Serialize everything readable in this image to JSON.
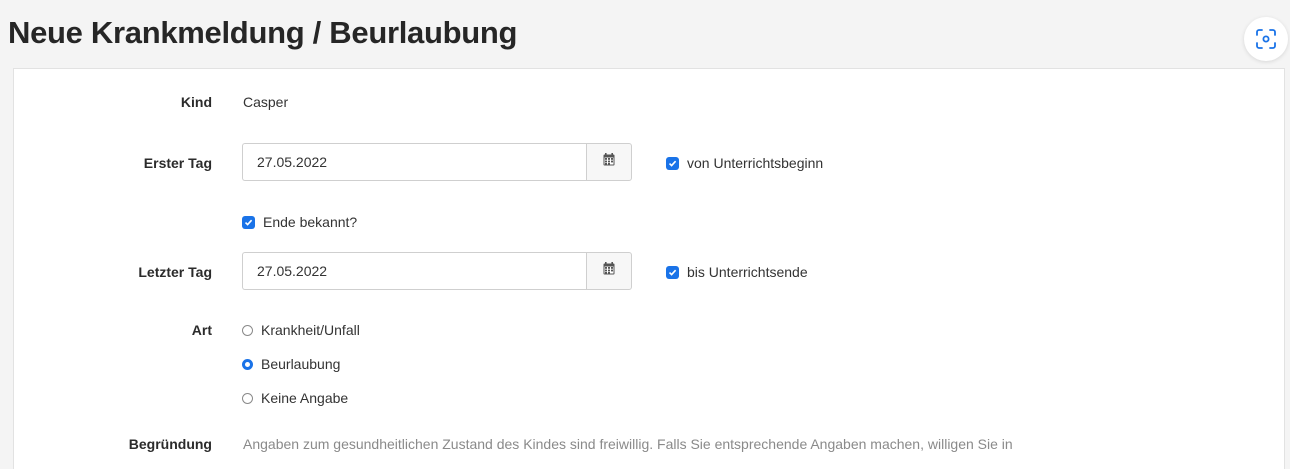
{
  "header": {
    "title": "Neue Krankmeldung / Beurlaubung",
    "screenshot_icon": "screenshot-capture-icon"
  },
  "form": {
    "kind": {
      "label": "Kind",
      "value": "Casper"
    },
    "erster_tag": {
      "label": "Erster Tag",
      "value": "27.05.2022",
      "calendar_icon": "calendar-icon",
      "option_label": "von Unterrichtsbeginn",
      "option_checked": true
    },
    "ende_bekannt": {
      "label": "Ende bekannt?",
      "checked": true
    },
    "letzter_tag": {
      "label": "Letzter Tag",
      "value": "27.05.2022",
      "calendar_icon": "calendar-icon",
      "option_label": "bis Unterrichtsende",
      "option_checked": true
    },
    "art": {
      "label": "Art",
      "options": [
        {
          "label": "Krankheit/Unfall",
          "selected": false
        },
        {
          "label": "Beurlaubung",
          "selected": true
        },
        {
          "label": "Keine Angabe",
          "selected": false
        }
      ]
    },
    "begruendung": {
      "label": "Begründung",
      "hint": "Angaben zum gesundheitlichen Zustand des Kindes sind freiwillig. Falls Sie entsprechende Angaben machen, willigen Sie in"
    }
  },
  "colors": {
    "accent": "#1a73e8",
    "background": "#f4f4f4",
    "panel": "#ffffff",
    "hint_text": "#8a8a8a"
  }
}
